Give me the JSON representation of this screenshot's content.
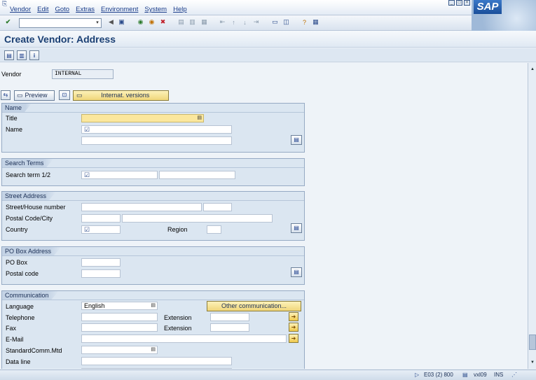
{
  "menu": {
    "items": [
      "Vendor",
      "Edit",
      "Goto",
      "Extras",
      "Environment",
      "System",
      "Help"
    ]
  },
  "logo": "SAP",
  "title": "Create Vendor: Address",
  "vendor": {
    "label": "Vendor",
    "value": "INTERNAL"
  },
  "toolbar2": {
    "preview": "Preview",
    "intl_versions": "Internat. versions"
  },
  "groups": {
    "name": {
      "title": "Name",
      "title_label": "Title",
      "name_label": "Name"
    },
    "search": {
      "title": "Search Terms",
      "term_label": "Search term 1/2"
    },
    "street": {
      "title": "Street Address",
      "street_label": "Street/House number",
      "postal_label": "Postal Code/City",
      "country_label": "Country",
      "region_label": "Region"
    },
    "pobox": {
      "title": "PO Box Address",
      "pobox_label": "PO Box",
      "postal_label": "Postal code"
    },
    "comm": {
      "title": "Communication",
      "language_label": "Language",
      "language_value": "English",
      "other_btn": "Other communication...",
      "telephone_label": "Telephone",
      "extension_label": "Extension",
      "fax_label": "Fax",
      "extension2_label": "Extension",
      "email_label": "E-Mail",
      "stdcomm_label": "StandardComm.Mtd",
      "dataline_label": "Data line"
    }
  },
  "status": {
    "system": "E03 (2) 800",
    "server": "vxl09",
    "mode": "INS"
  },
  "colors": {
    "title": "#1a3f73",
    "required": "#fbe79d",
    "button": "#f0d67a"
  }
}
